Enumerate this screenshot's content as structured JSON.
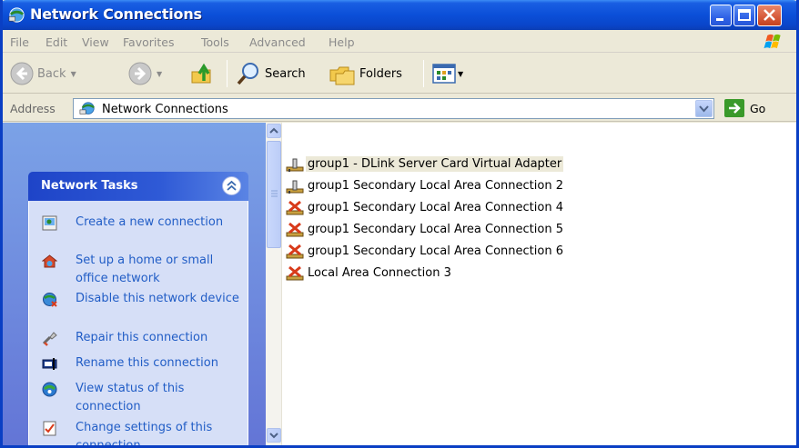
{
  "window": {
    "title": "Network Connections"
  },
  "menu": {
    "items": [
      "File",
      "Edit",
      "View",
      "Favorites",
      "Tools",
      "Advanced",
      "Help"
    ]
  },
  "toolbar": {
    "back_label": "Back",
    "search_label": "Search",
    "folders_label": "Folders"
  },
  "address": {
    "label": "Address",
    "value": "Network Connections",
    "go_label": "Go"
  },
  "taskpane": {
    "title": "Network Tasks",
    "items": [
      {
        "label": "Create a new connection",
        "icon": "new-connection-icon"
      },
      {
        "label": "Set up a home or small office network",
        "icon": "home-network-icon"
      },
      {
        "label": "Disable this network device",
        "icon": "disable-device-icon"
      },
      {
        "label": "Repair this connection",
        "icon": "repair-icon"
      },
      {
        "label": "Rename this connection",
        "icon": "rename-icon"
      },
      {
        "label": "View status of this connection",
        "icon": "status-icon"
      },
      {
        "label": "Change settings of this connection",
        "icon": "settings-icon"
      }
    ]
  },
  "connections": [
    {
      "name": "group1 - DLink Server Card Virtual Adapter",
      "status": "connected",
      "selected": true
    },
    {
      "name": "group1 Secondary Local Area Connection 2",
      "status": "connected",
      "selected": false
    },
    {
      "name": "group1 Secondary Local Area Connection 4",
      "status": "disconnected",
      "selected": false
    },
    {
      "name": "group1 Secondary Local Area Connection 5",
      "status": "disconnected",
      "selected": false
    },
    {
      "name": "group1 Secondary Local Area Connection 6",
      "status": "disconnected",
      "selected": false
    },
    {
      "name": "Local Area Connection 3",
      "status": "disconnected",
      "selected": false
    }
  ],
  "colors": {
    "titlebar": "#0b4fd8",
    "task_link": "#215dc6",
    "task_header": "#1e44c8",
    "disconnected": "#d83a1a"
  }
}
